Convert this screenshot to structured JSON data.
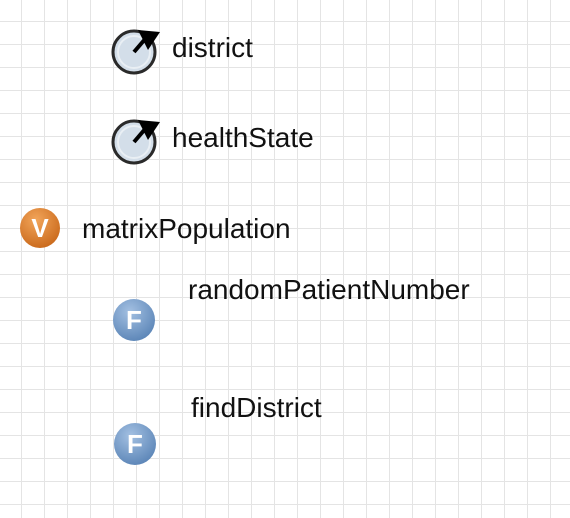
{
  "elements": [
    {
      "kind": "parameter",
      "icon": "parameter-dial-icon",
      "label": "district"
    },
    {
      "kind": "parameter",
      "icon": "parameter-dial-icon",
      "label": "healthState"
    },
    {
      "kind": "variable",
      "icon": "variable-v-icon",
      "icon_letter": "V",
      "label": "matrixPopulation"
    },
    {
      "kind": "function",
      "icon": "function-f-icon",
      "icon_letter": "F",
      "label": "randomPatientNumber"
    },
    {
      "kind": "function",
      "icon": "function-f-icon",
      "icon_letter": "F",
      "label": "findDistrict"
    }
  ],
  "colors": {
    "parameter_fill": "#d3dee9",
    "variable_fill": "#d97a25",
    "function_fill": "#6f96c4"
  }
}
